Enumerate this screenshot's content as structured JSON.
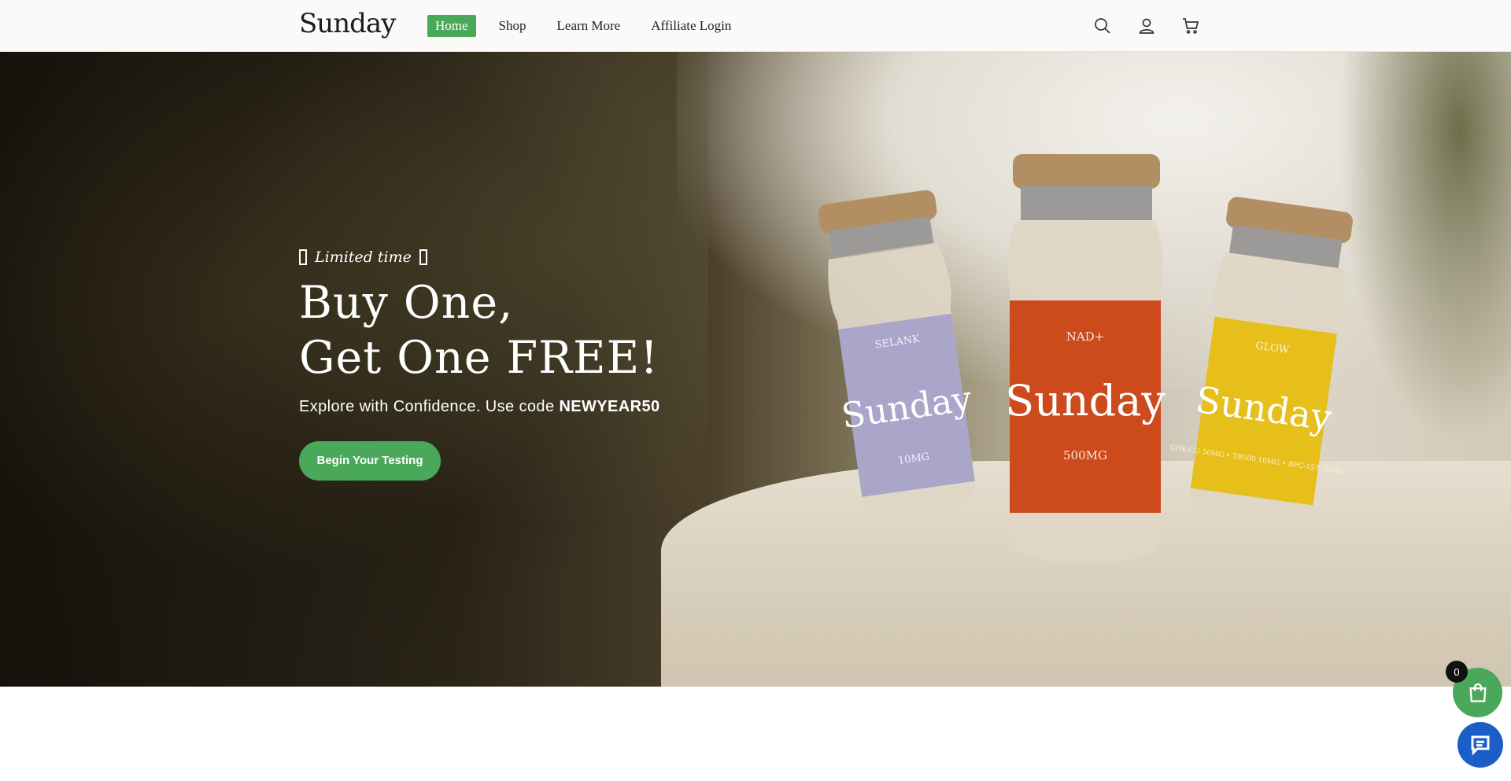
{
  "header": {
    "logo": "Sunday",
    "nav": [
      {
        "label": "Home",
        "active": true
      },
      {
        "label": "Shop",
        "active": false
      },
      {
        "label": "Learn More",
        "active": false
      },
      {
        "label": "Affiliate Login",
        "active": false
      }
    ],
    "icons": [
      "search-icon",
      "account-icon",
      "cart-icon"
    ]
  },
  "hero": {
    "tagline": "Limited time",
    "headline_line1": "Buy One,",
    "headline_line2": "Get One FREE!",
    "subtext_prefix": "Explore with Confidence. Use code ",
    "promo_code": "NEWYEAR50",
    "cta_label": "Begin Your Testing",
    "vials": [
      {
        "name": "SELANK",
        "brand": "Sunday",
        "dose": "10MG",
        "color": "#a9a6c9"
      },
      {
        "name": "NAD+",
        "brand": "Sunday",
        "dose": "500MG",
        "color": "#cc4a1c"
      },
      {
        "name": "GLOW",
        "brand": "Sunday",
        "dose": "GHK-CU 50MG • TB500 10MG • BPC-157 10MG",
        "color": "#e6bf1a"
      }
    ]
  },
  "floating": {
    "cart_count": "0"
  },
  "colors": {
    "accent": "#4aa85a",
    "chat": "#1b5ec7"
  }
}
